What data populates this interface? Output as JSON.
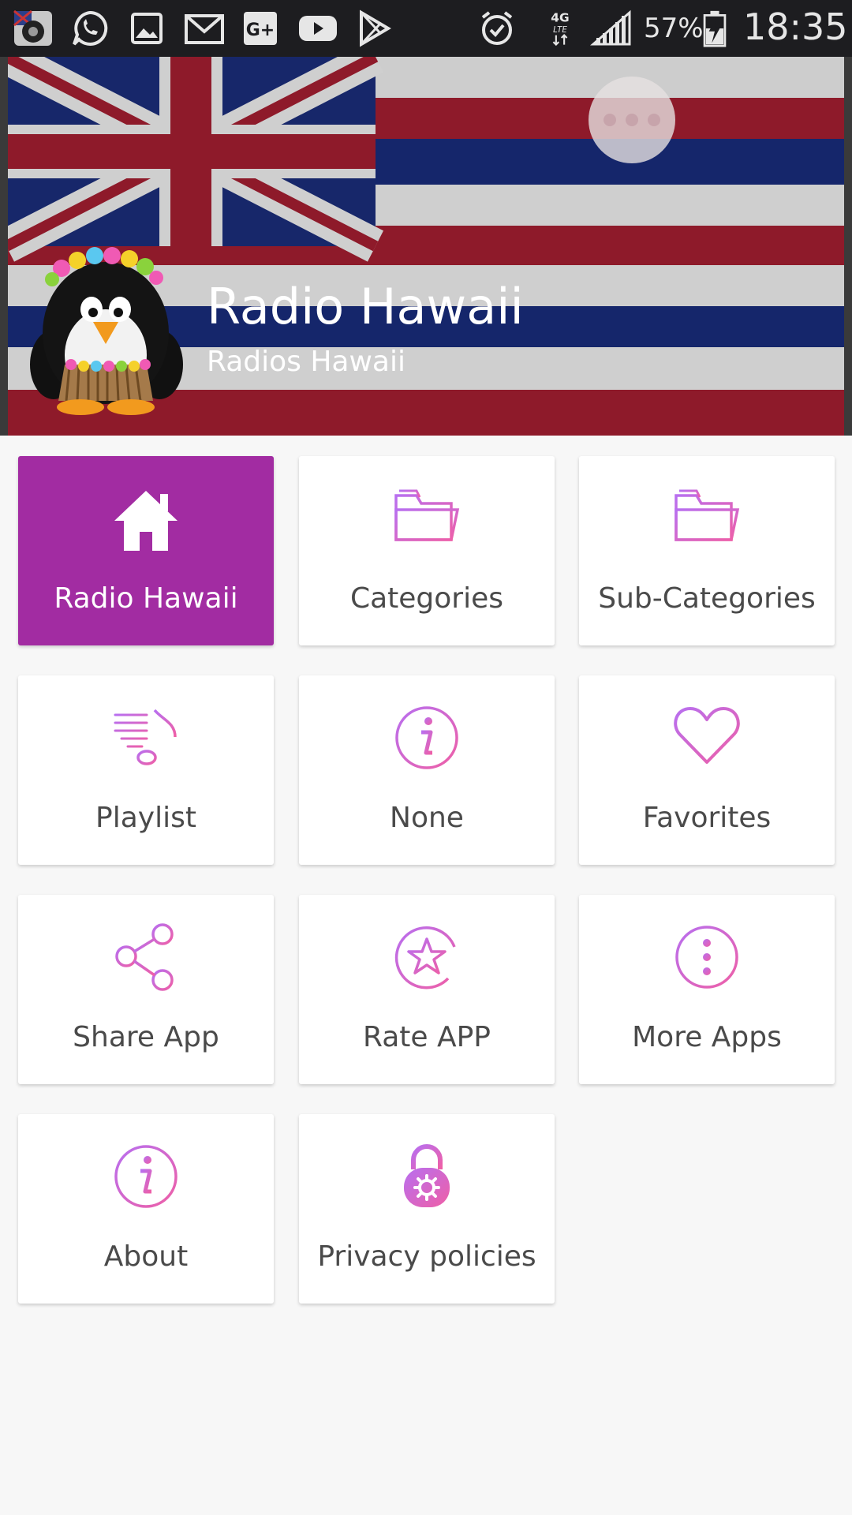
{
  "status_bar": {
    "battery": "57%",
    "time": "18:35",
    "network": "4G LTE",
    "notification_icons": [
      "hawaii-radio-icon",
      "whatsapp-icon",
      "gallery-icon",
      "gmail-icon",
      "google-plus-icon",
      "youtube-icon",
      "play-store-icon"
    ]
  },
  "header": {
    "title": "Radio Hawaii",
    "subtitle": "Radios Hawaii",
    "menu_icon": "more-dots-icon"
  },
  "colors": {
    "accent": "#a22ca2",
    "icon_gradient_start": "#b86ff0",
    "icon_gradient_end": "#ef5fa6",
    "background": "#f7f7f7"
  },
  "menu": [
    {
      "label": "Radio Hawaii",
      "icon": "home-icon",
      "active": true
    },
    {
      "label": "Categories",
      "icon": "folder-icon",
      "active": false
    },
    {
      "label": "Sub-Categories",
      "icon": "folder-icon",
      "active": false
    },
    {
      "label": "Playlist",
      "icon": "playlist-icon",
      "active": false
    },
    {
      "label": "None",
      "icon": "info-icon",
      "active": false
    },
    {
      "label": "Favorites",
      "icon": "heart-icon",
      "active": false
    },
    {
      "label": "Share App",
      "icon": "share-icon",
      "active": false
    },
    {
      "label": "Rate APP",
      "icon": "star-icon",
      "active": false
    },
    {
      "label": "More Apps",
      "icon": "more-vertical-icon",
      "active": false
    },
    {
      "label": "About",
      "icon": "info-icon",
      "active": false
    },
    {
      "label": "Privacy policies",
      "icon": "lock-gear-icon",
      "active": false
    }
  ]
}
